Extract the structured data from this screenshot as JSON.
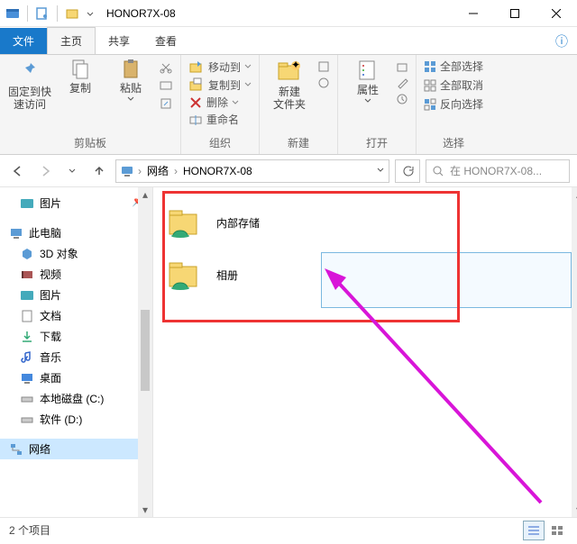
{
  "window": {
    "title": "HONOR7X-08"
  },
  "tabs": {
    "file": "文件",
    "home": "主页",
    "share": "共享",
    "view": "查看"
  },
  "ribbon": {
    "clipboard": {
      "label": "剪贴板",
      "pin": "固定到快\n速访问",
      "copy": "复制",
      "paste": "粘贴"
    },
    "organize": {
      "label": "组织",
      "moveTo": "移动到",
      "copyTo": "复制到",
      "delete": "删除",
      "rename": "重命名"
    },
    "new": {
      "label": "新建",
      "newFolder": "新建\n文件夹"
    },
    "open": {
      "label": "打开",
      "properties": "属性"
    },
    "select": {
      "label": "选择",
      "selectAll": "全部选择",
      "selectNone": "全部取消",
      "invert": "反向选择"
    }
  },
  "breadcrumbs": {
    "seg1": "网络",
    "seg2": "HONOR7X-08"
  },
  "search": {
    "placeholder": "在 HONOR7X-08..."
  },
  "navpane": {
    "pictures": "图片",
    "thisPC": "此电脑",
    "obj3d": "3D 对象",
    "videos": "视频",
    "pics2": "图片",
    "docs": "文档",
    "downloads": "下载",
    "music": "音乐",
    "desktop": "桌面",
    "cdrive": "本地磁盘 (C:)",
    "ddrive": "软件 (D:)",
    "network": "网络"
  },
  "items": {
    "internal": "内部存储",
    "album": "相册"
  },
  "status": {
    "count": "2 个项目"
  }
}
